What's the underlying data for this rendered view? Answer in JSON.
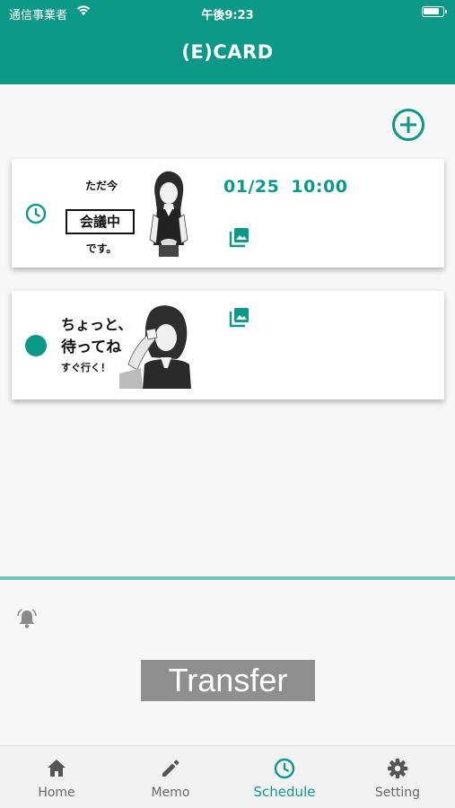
{
  "status_bar": {
    "carrier": "通信事業者",
    "time": "午後9:23",
    "battery_level": 0.85
  },
  "header": {
    "title": "(E)CARD"
  },
  "toolbar": {
    "add_icon": "add-circle-icon"
  },
  "cards": [
    {
      "indicator_icon": "clock-icon",
      "sticker": {
        "line1": "ただ今",
        "line2": "会議中",
        "line3": "です。"
      },
      "datetime": "01/25  10:00",
      "image_icon": "image-gallery-icon"
    },
    {
      "indicator_icon": "filled-dot-icon",
      "sticker": {
        "line1": "ちょっと、",
        "line2": "待ってね",
        "line3": "すぐ行く！"
      },
      "image_icon": "image-gallery-icon"
    }
  ],
  "lower": {
    "bell_icon": "bell-icon",
    "transfer_label": "Transfer"
  },
  "tabbar": {
    "tabs": [
      {
        "label": "Home",
        "icon": "home-icon"
      },
      {
        "label": "Memo",
        "icon": "pencil-icon"
      },
      {
        "label": "Schedule",
        "icon": "clock-icon",
        "active": true
      },
      {
        "label": "Setting",
        "icon": "gear-icon"
      }
    ]
  },
  "colors": {
    "accent": "#0c9887",
    "divider": "#6dc4bb",
    "transfer_bg": "#8f8f8f",
    "inactive": "#666666"
  }
}
